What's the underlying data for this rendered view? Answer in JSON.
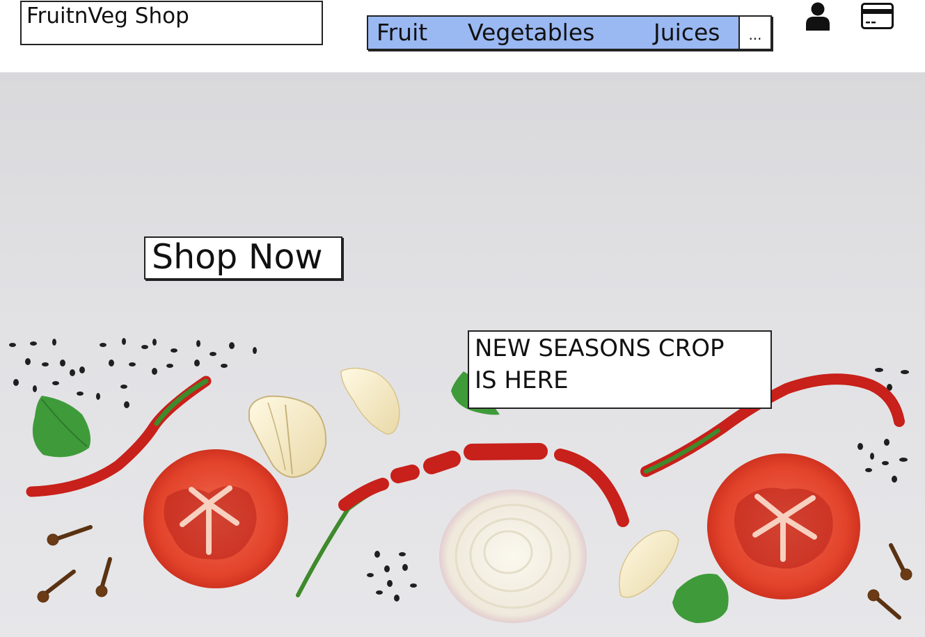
{
  "header": {
    "logo": "FruitnVeg Shop",
    "nav": {
      "items": [
        {
          "label": "Fruit"
        },
        {
          "label": "Vegetables"
        },
        {
          "label": "Juices"
        }
      ],
      "more_label": "...",
      "highlight_color": "#9ab8f2"
    },
    "icons": [
      "user-icon",
      "credit-card-icon"
    ]
  },
  "hero": {
    "cta_label": "Shop Now",
    "announcement_line1": "NEW SEASONS CROP",
    "announcement_line2": "IS HERE",
    "background_color": "#e1e1e4"
  }
}
